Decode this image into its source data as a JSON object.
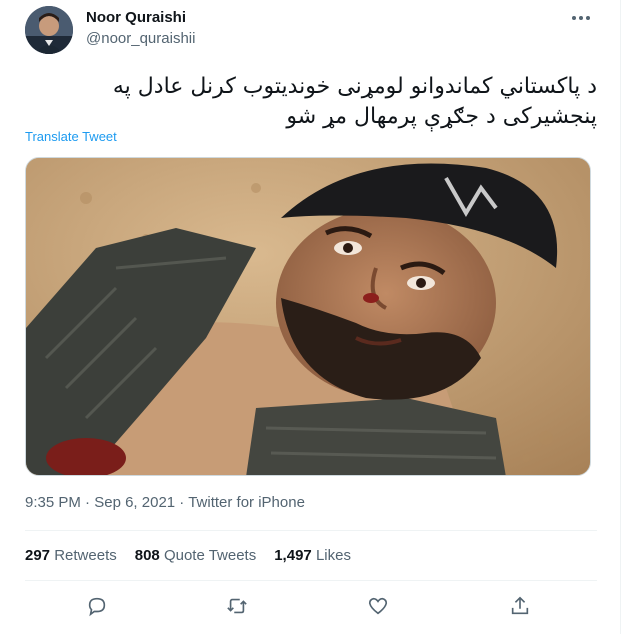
{
  "author": {
    "name": "Noor Quraishi",
    "handle": "@noor_quraishii"
  },
  "tweet": {
    "text_line1": "د پاکستاني کماندوانو لومړنی خوندیتوب کرنل عادل په",
    "text_line2": "پنجشیرکی د جګړې پرمهال مړ شو",
    "translate_label": "Translate Tweet",
    "time": "9:35 PM",
    "date": "Sep 6, 2021",
    "source": "Twitter for iPhone"
  },
  "stats": {
    "retweets_count": "297",
    "retweets_label": "Retweets",
    "quotes_count": "808",
    "quotes_label": "Quote Tweets",
    "likes_count": "1,497",
    "likes_label": "Likes"
  },
  "icons": {
    "more": "more-dots-icon",
    "reply": "reply-icon",
    "retweet": "retweet-icon",
    "like": "heart-icon",
    "share": "share-icon"
  },
  "colors": {
    "accent": "#1d9bf0",
    "secondary_text": "#536471",
    "primary_text": "#0f1419",
    "divider": "#eff3f4"
  }
}
